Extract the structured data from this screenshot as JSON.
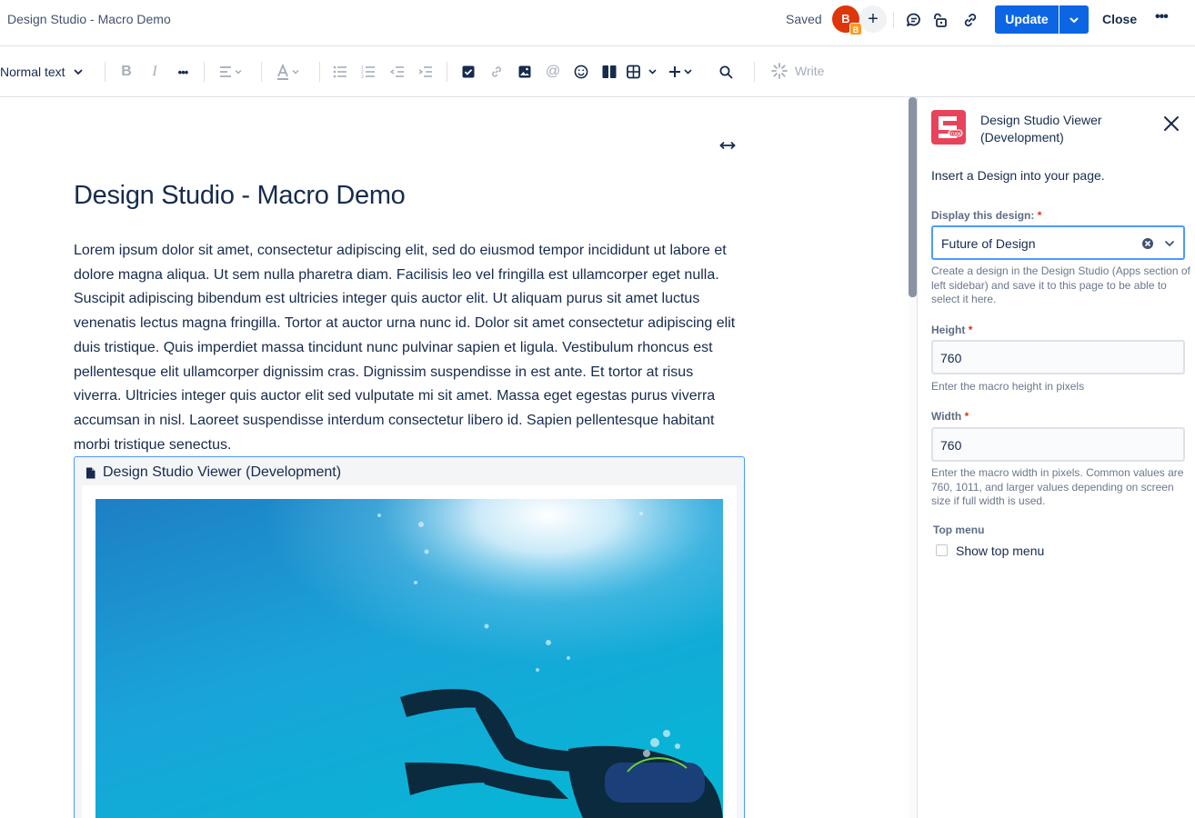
{
  "header": {
    "doc_title": "Design Studio - Macro Demo",
    "saved_status": "Saved",
    "avatar_initial": "B",
    "avatar_badge": "B",
    "add_collaborator": "+",
    "update_label": "Update",
    "close_label": "Close",
    "more_label": "•••",
    "icons": [
      "comment-icon",
      "unlock-icon",
      "link-icon",
      "chevron-down-icon",
      "more-icon"
    ]
  },
  "toolbar": {
    "text_style": "Normal text",
    "write_label": "Write",
    "items": [
      "bold",
      "italic",
      "more-formatting",
      "align",
      "text-color",
      "bullet-list",
      "numbered-list",
      "outdent",
      "indent",
      "action-item",
      "link",
      "image",
      "mention",
      "emoji",
      "layouts",
      "table",
      "insert",
      "find-replace"
    ]
  },
  "editor": {
    "page_title": "Design Studio - Macro Demo",
    "body_text": "Lorem ipsum dolor sit amet, consectetur adipiscing elit, sed do eiusmod tempor incididunt ut labore et dolore magna aliqua. Ut sem nulla pharetra diam. Facilisis leo vel fringilla est ullamcorper eget nulla. Suscipit adipiscing bibendum est ultricies integer quis auctor elit. Ut aliquam purus sit amet luctus venenatis lectus magna fringilla. Tortor at auctor urna nunc id. Dolor sit amet consectetur adipiscing elit duis tristique. Quis imperdiet massa tincidunt nunc pulvinar sapien et ligula. Vestibulum rhoncus est pellentesque elit ullamcorper dignissim cras. Dignissim suspendisse in est ante. Et tortor at risus viverra. Ultricies integer quis auctor elit sed vulputate mi sit amet. Massa eget egestas purus viverra accumsan in nisl. Laoreet suspendisse interdum consectetur libero id. Sapien pellentesque habitant morbi tristique senectus.",
    "macro_title": "Design Studio Viewer (Development)"
  },
  "panel": {
    "title": "Design Studio Viewer (Development)",
    "logo_text": "STUDIO",
    "intro": "Insert a Design into your page.",
    "display_label": "Display this design:",
    "display_value": "Future of Design",
    "display_help": "Create a design in the Design Studio (Apps section of left sidebar) and save it to this page to be able to select it here.",
    "height_label": "Height",
    "height_value": "760",
    "height_help": "Enter the macro height in pixels",
    "width_label": "Width",
    "width_value": "760",
    "width_help": "Enter the macro width in pixels. Common values are 760, 1011, and larger values depending on screen size if full width is used.",
    "top_menu_label": "Top menu",
    "show_top_menu_label": "Show top menu",
    "show_top_menu_checked": false,
    "required_marker": "*"
  },
  "colors": {
    "primary": "#0c66e4",
    "text": "#172b4d",
    "avatar": "#de350b",
    "badge": "#ff991f",
    "logo": "#e8435a",
    "focus": "#4c9aff",
    "required": "#de350b"
  }
}
